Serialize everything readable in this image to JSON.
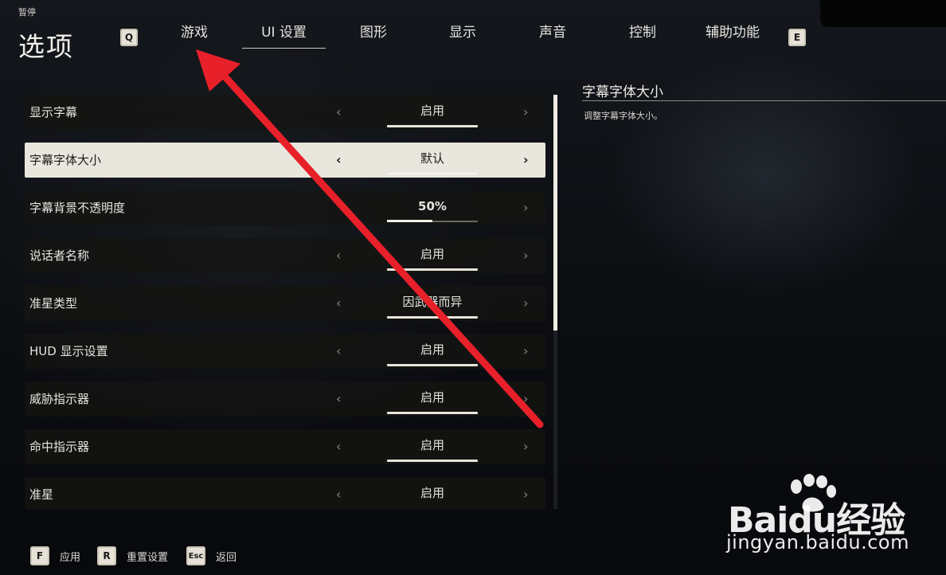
{
  "header": {
    "pause_label": "暂停",
    "title": "选项",
    "prev_key": "Q",
    "next_key": "E",
    "tabs": [
      {
        "label": "游戏"
      },
      {
        "label": "UI 设置"
      },
      {
        "label": "图形"
      },
      {
        "label": "显示"
      },
      {
        "label": "声音"
      },
      {
        "label": "控制"
      },
      {
        "label": "辅助功能"
      }
    ],
    "active_tab": "UI 设置"
  },
  "settings": [
    {
      "label": "显示字幕",
      "value": "启用",
      "selected": false
    },
    {
      "label": "字幕字体大小",
      "value": "默认",
      "selected": true
    },
    {
      "label": "字幕背景不透明度",
      "value": "50%",
      "slider_fraction": 0.5,
      "selected": false
    },
    {
      "label": "说话者名称",
      "value": "启用",
      "selected": false
    },
    {
      "label": "准星类型",
      "value": "因武器而异",
      "selected": false
    },
    {
      "label": "HUD 显示设置",
      "value": "启用",
      "selected": false
    },
    {
      "label": "威胁指示器",
      "value": "启用",
      "selected": false
    },
    {
      "label": "命中指示器",
      "value": "启用",
      "selected": false
    },
    {
      "label": "准星",
      "value": "启用",
      "selected": false
    }
  ],
  "description": {
    "title": "字幕字体大小",
    "text": "调整字幕字体大小。"
  },
  "footer": [
    {
      "key": "F",
      "label": "应用"
    },
    {
      "key": "R",
      "label": "重置设置"
    },
    {
      "key": "Esc",
      "label": "返回"
    }
  ],
  "watermark": {
    "brand": "Baidu经验",
    "url": "jingyan.baidu.com"
  },
  "colors": {
    "arrow": "#e8202a",
    "selected_row": "#e9e6de",
    "background": "#0b0d11"
  }
}
